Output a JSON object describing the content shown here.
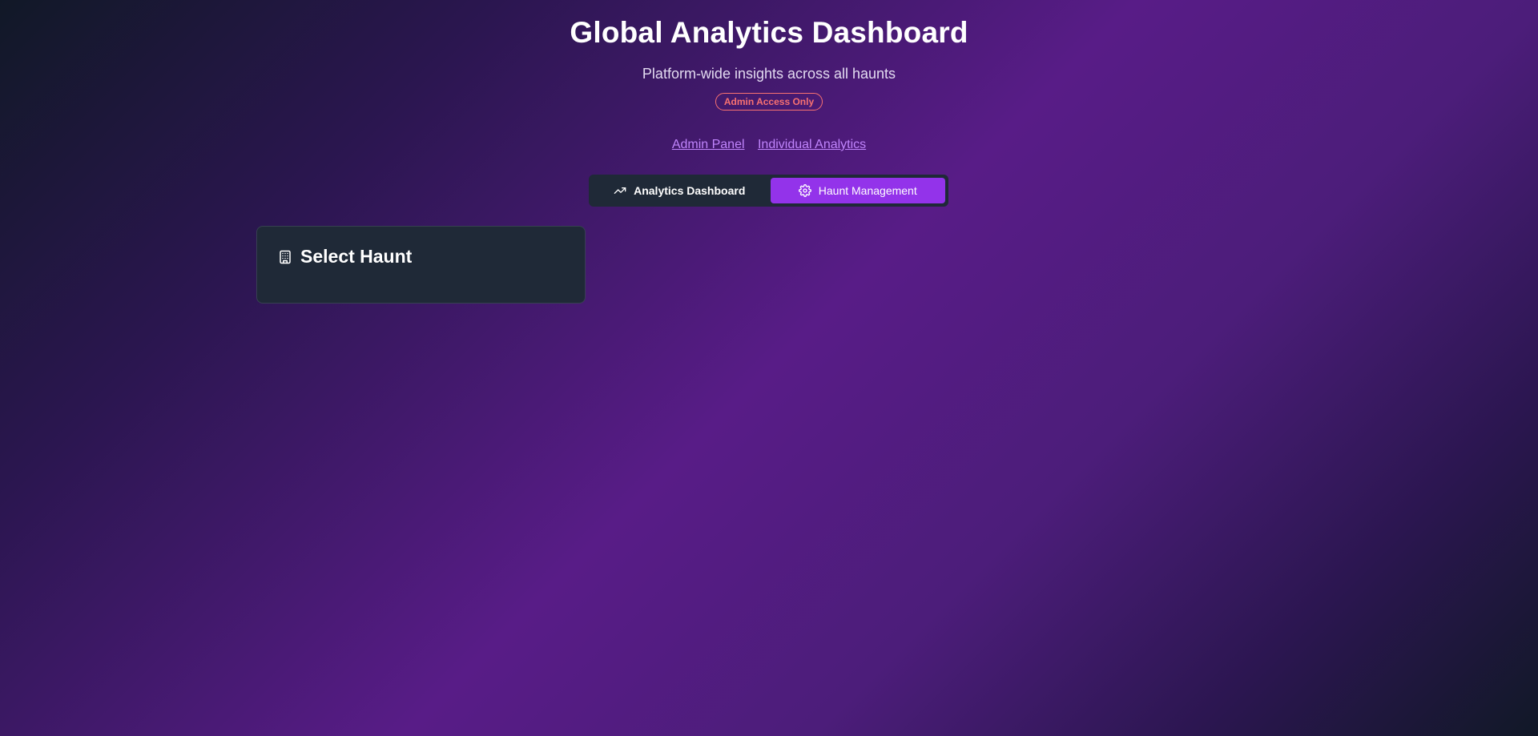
{
  "header": {
    "title": "Global Analytics Dashboard",
    "subtitle": "Platform-wide insights across all haunts",
    "badge": "Admin Access Only"
  },
  "links": [
    {
      "label": "Admin Panel"
    },
    {
      "label": "Individual Analytics"
    }
  ],
  "tabs": [
    {
      "label": "Analytics Dashboard",
      "icon": "trending-up-icon",
      "active": false
    },
    {
      "label": "Haunt Management",
      "icon": "gear-icon",
      "active": true
    }
  ],
  "card": {
    "title": "Select Haunt",
    "icon": "building-icon"
  },
  "colors": {
    "accent": "#9333ea",
    "badge": "#f87171",
    "link": "#c084fc",
    "panel": "#1f2937"
  }
}
